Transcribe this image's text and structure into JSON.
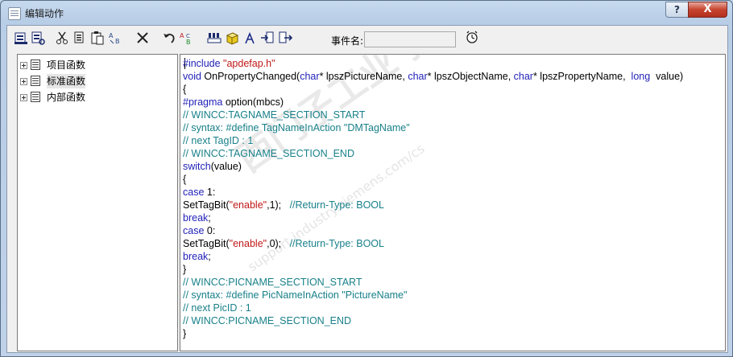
{
  "window": {
    "title": "编辑动作",
    "help_label": "?",
    "close_label": "X"
  },
  "toolbar": {
    "icons": [
      "compile-all-icon",
      "compile-icon",
      "cut-icon",
      "copy-icon",
      "paste-icon",
      "format-icon",
      "delete-icon",
      "undo-icon",
      "replace-icon",
      "tag-icon",
      "object-icon",
      "lambda-icon",
      "import-icon",
      "export-icon"
    ],
    "event_label": "事件名:",
    "event_value": "",
    "trigger_icon": "clock-icon"
  },
  "tree": {
    "items": [
      {
        "label": "项目函数"
      },
      {
        "label": "标准函数"
      },
      {
        "label": "内部函数"
      }
    ]
  },
  "editor": {
    "watermark": "西门子工业 技术论坛",
    "watermark_url": "support.industry.siemens.com/cs",
    "lines": [
      [
        {
          "t": "#include ",
          "c": "kw"
        },
        {
          "t": "\"apdefap.h\"",
          "c": "st"
        }
      ],
      [
        {
          "t": "void ",
          "c": "kw"
        },
        {
          "t": "OnPropertyChanged(",
          "c": "pl"
        },
        {
          "t": "char",
          "c": "kw"
        },
        {
          "t": "* lpszPictureName, ",
          "c": "pl"
        },
        {
          "t": "char",
          "c": "kw"
        },
        {
          "t": "* lpszObjectName, ",
          "c": "pl"
        },
        {
          "t": "char",
          "c": "kw"
        },
        {
          "t": "* lpszPropertyName,  ",
          "c": "pl"
        },
        {
          "t": "long",
          "c": "kw"
        },
        {
          "t": "  value)",
          "c": "pl"
        }
      ],
      [
        {
          "t": "{",
          "c": "pl"
        }
      ],
      [
        {
          "t": "#pragma ",
          "c": "kw"
        },
        {
          "t": "option(mbcs)",
          "c": "pl"
        }
      ],
      [
        {
          "t": "// WINCC:TAGNAME_SECTION_START",
          "c": "cm"
        }
      ],
      [
        {
          "t": "// syntax: #define TagNameInAction \"DMTagName\"",
          "c": "cm"
        }
      ],
      [
        {
          "t": "// next TagID : 1",
          "c": "cm"
        }
      ],
      [
        {
          "t": "// WINCC:TAGNAME_SECTION_END",
          "c": "cm"
        }
      ],
      [
        {
          "t": "switch",
          "c": "kw"
        },
        {
          "t": "(value)",
          "c": "pl"
        }
      ],
      [
        {
          "t": "{",
          "c": "pl"
        }
      ],
      [
        {
          "t": "case ",
          "c": "kw"
        },
        {
          "t": "1:",
          "c": "pl"
        }
      ],
      [
        {
          "t": "SetTagBit(",
          "c": "pl"
        },
        {
          "t": "\"enable\"",
          "c": "st"
        },
        {
          "t": ",1);   ",
          "c": "pl"
        },
        {
          "t": "//Return-Type: BOOL",
          "c": "cm"
        }
      ],
      [
        {
          "t": "break",
          "c": "kw"
        },
        {
          "t": ";",
          "c": "pl"
        }
      ],
      [
        {
          "t": "case ",
          "c": "kw"
        },
        {
          "t": "0:",
          "c": "pl"
        }
      ],
      [
        {
          "t": "SetTagBit(",
          "c": "pl"
        },
        {
          "t": "\"enable\"",
          "c": "st"
        },
        {
          "t": ",0);   ",
          "c": "pl"
        },
        {
          "t": "//Return-Type: BOOL",
          "c": "cm"
        }
      ],
      [
        {
          "t": "break",
          "c": "kw"
        },
        {
          "t": ";",
          "c": "pl"
        }
      ],
      [
        {
          "t": "}",
          "c": "pl"
        }
      ],
      [
        {
          "t": "// WINCC:PICNAME_SECTION_START",
          "c": "cm"
        }
      ],
      [
        {
          "t": "// syntax: #define PicNameInAction \"PictureName\"",
          "c": "cm"
        }
      ],
      [
        {
          "t": "// next PicID : 1",
          "c": "cm"
        }
      ],
      [
        {
          "t": "// WINCC:PICNAME_SECTION_END",
          "c": "cm"
        }
      ],
      [
        {
          "t": "}",
          "c": "pl"
        }
      ]
    ]
  }
}
